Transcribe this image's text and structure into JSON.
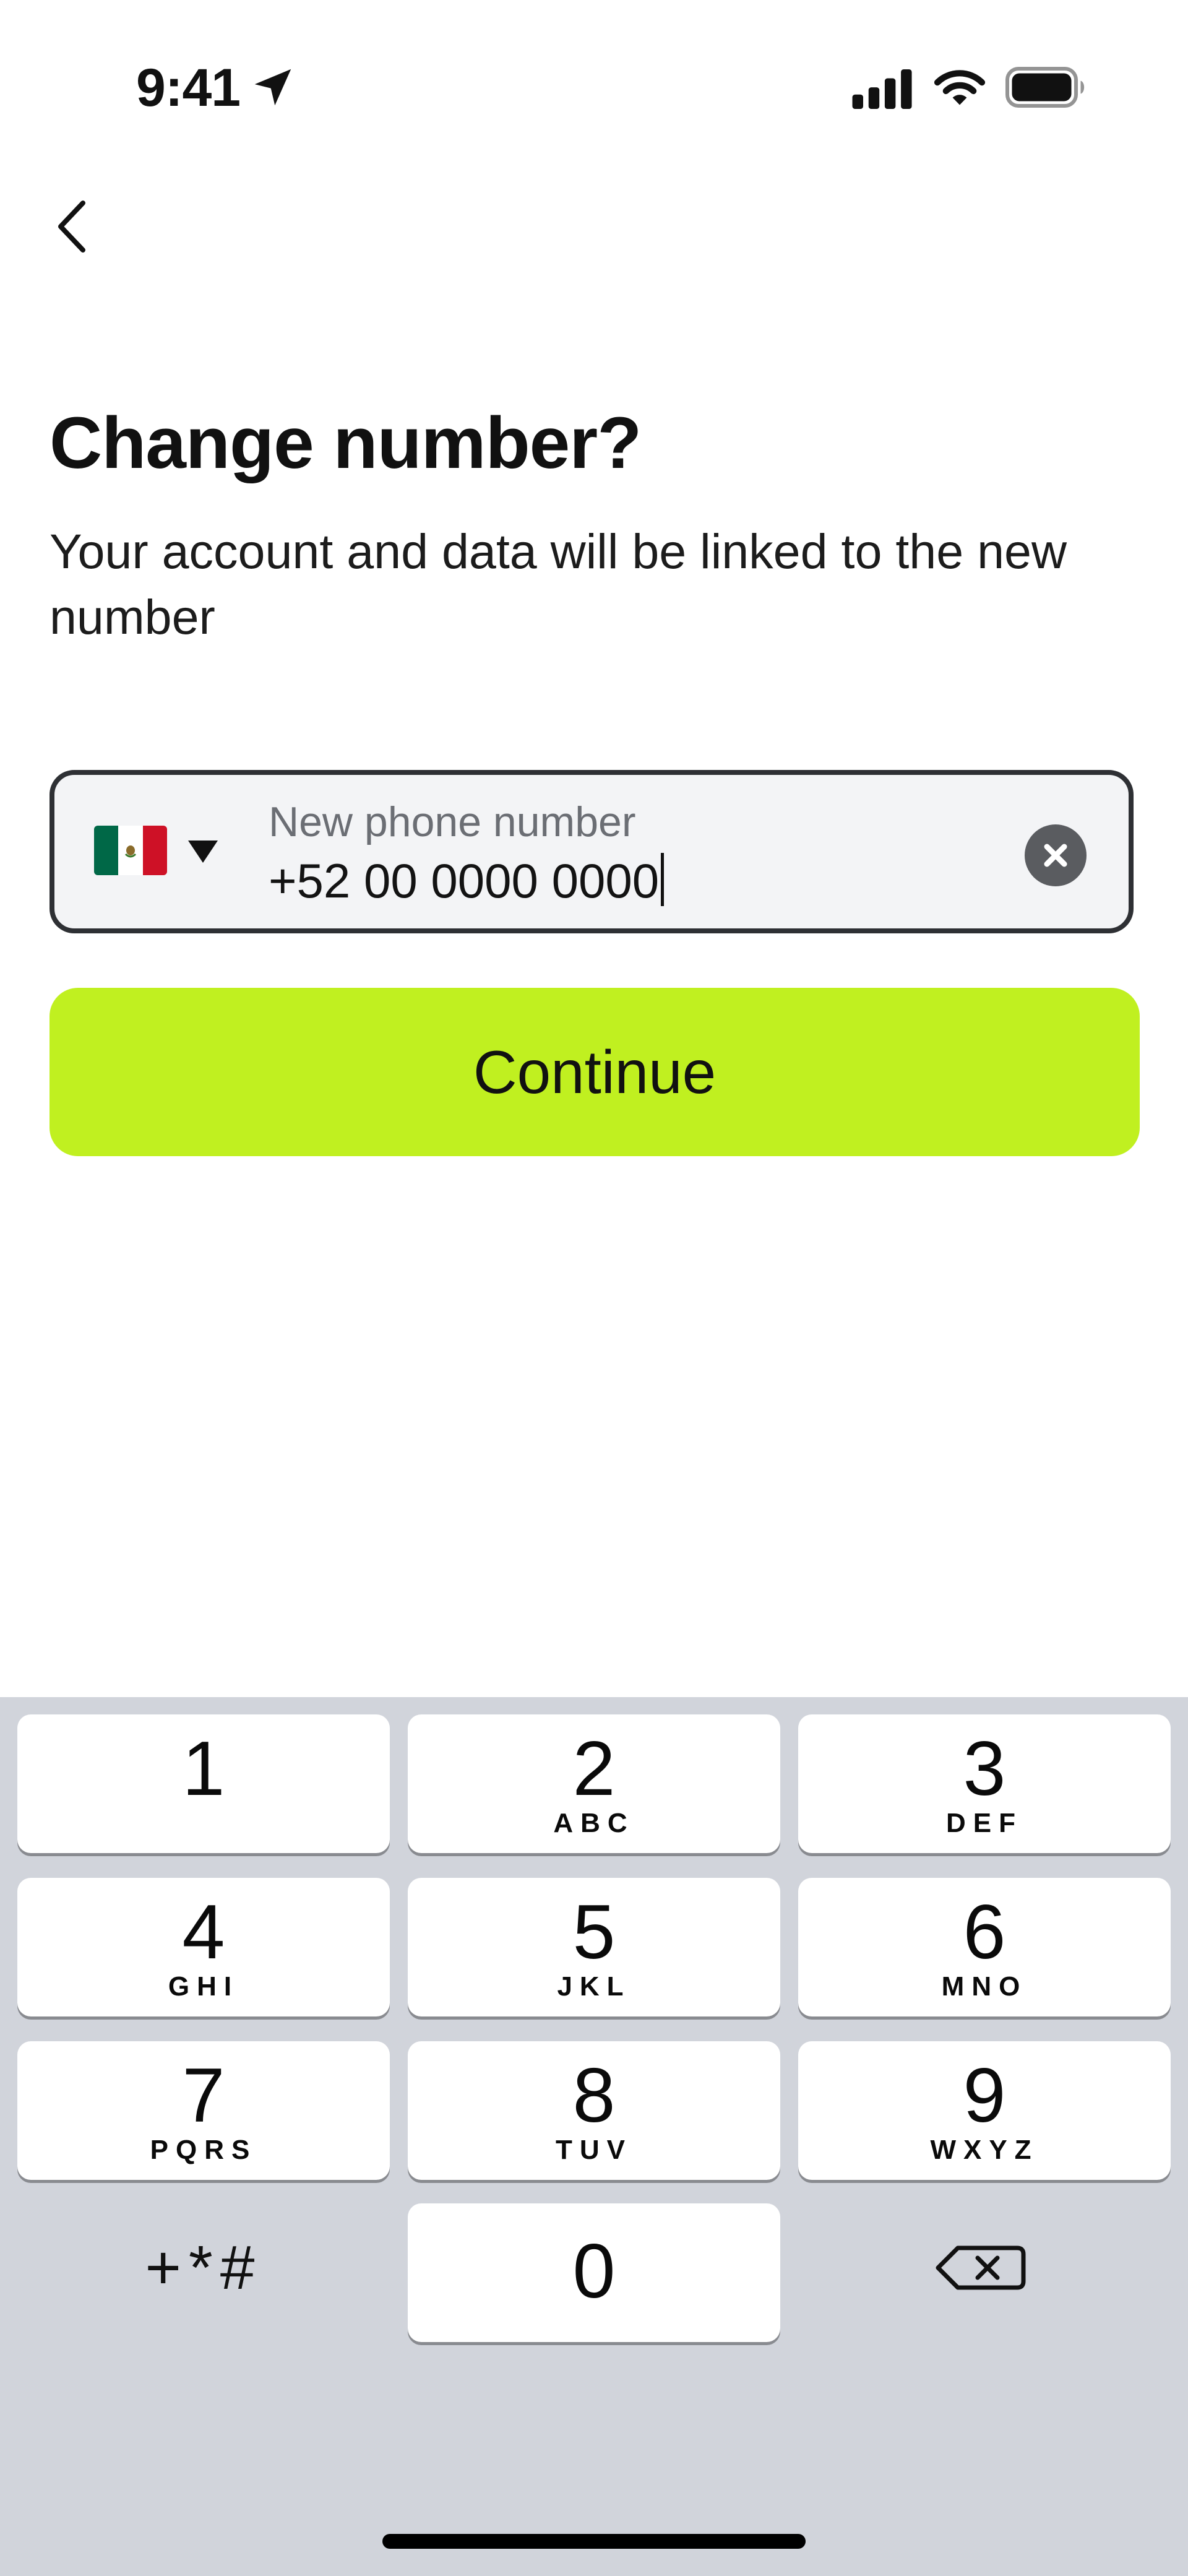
{
  "status_bar": {
    "time": "9:41",
    "icons": [
      "location-arrow-icon",
      "cellular-signal-icon",
      "wifi-icon",
      "battery-icon"
    ]
  },
  "nav": {
    "back_icon": "chevron-left-icon"
  },
  "header": {
    "title": "Change number?",
    "subtitle": "Your account and data will be linked to the new number"
  },
  "phone_input": {
    "country_flag": "mexico-flag-icon",
    "label": "New phone number",
    "value": "+52 00 0000 0000",
    "clear_icon": "clear-x-icon"
  },
  "continue_button": {
    "label": "Continue"
  },
  "keypad": {
    "keys": [
      {
        "digit": "1",
        "letters": ""
      },
      {
        "digit": "2",
        "letters": "ABC"
      },
      {
        "digit": "3",
        "letters": "DEF"
      },
      {
        "digit": "4",
        "letters": "GHI"
      },
      {
        "digit": "5",
        "letters": "JKL"
      },
      {
        "digit": "6",
        "letters": "MNO"
      },
      {
        "digit": "7",
        "letters": "PQRS"
      },
      {
        "digit": "8",
        "letters": "TUV"
      },
      {
        "digit": "9",
        "letters": "WXYZ"
      },
      {
        "digit": "0",
        "letters": ""
      }
    ],
    "symbols_label": "+*#",
    "delete_icon": "backspace-icon"
  },
  "colors": {
    "accent": "#c0f020",
    "field_background": "#f3f4f6",
    "field_border": "#2e3034",
    "keypad_background": "#d1d4db",
    "flag_green": "#006847",
    "flag_white": "#ffffff",
    "flag_red": "#ce1126"
  }
}
